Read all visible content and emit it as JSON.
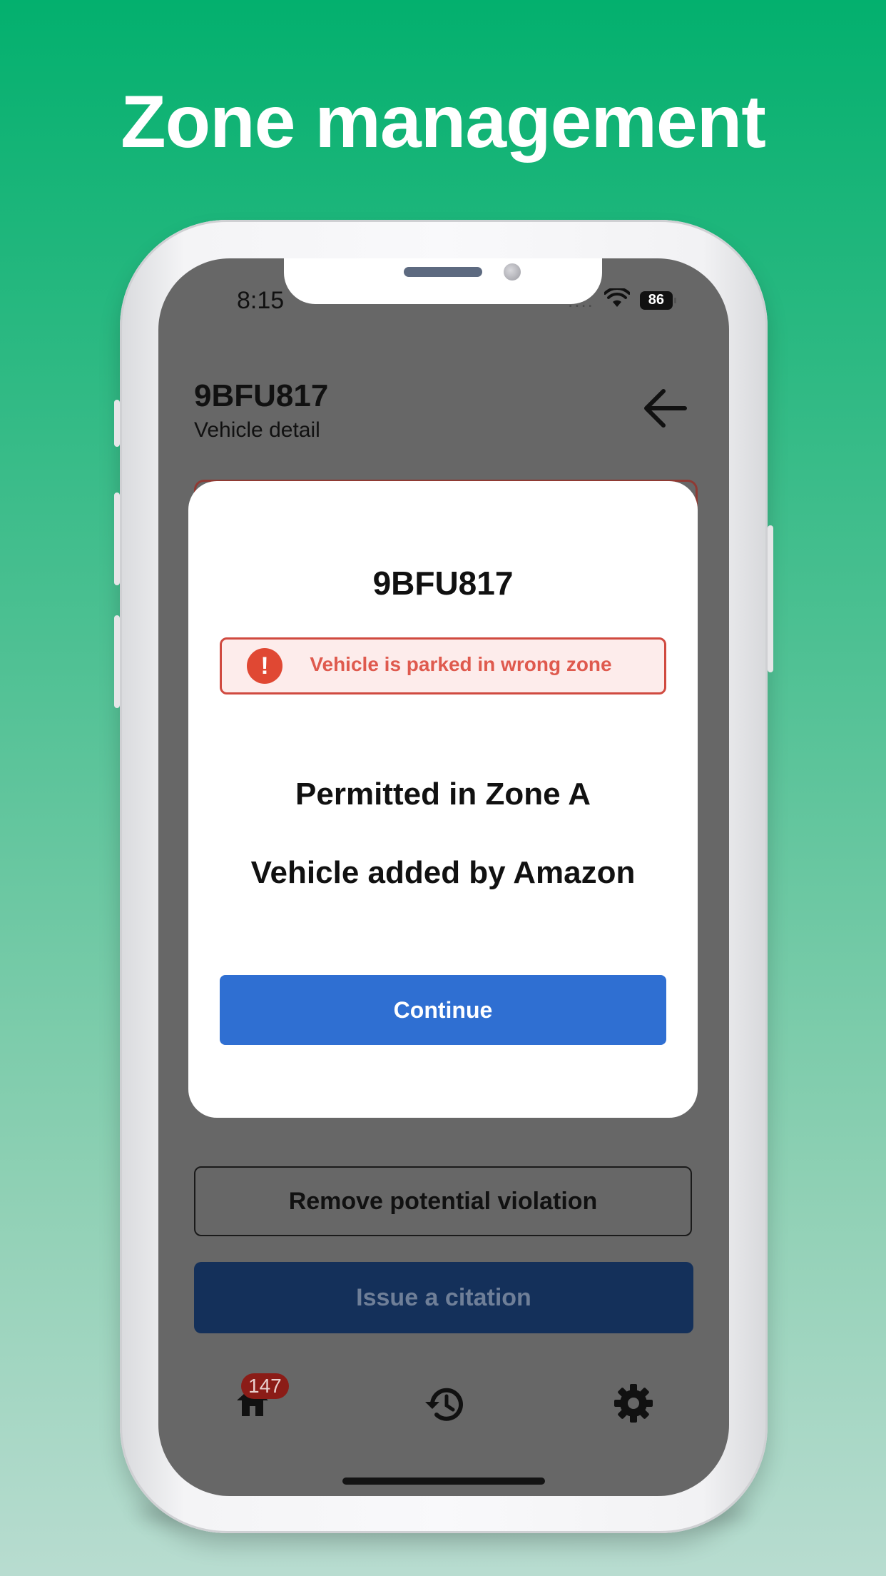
{
  "headline": "Zone management",
  "status_bar": {
    "time": "8:15",
    "signal": "....",
    "battery": "86"
  },
  "header": {
    "plate": "9BFU817",
    "subtitle": "Vehicle detail"
  },
  "modal": {
    "plate": "9BFU817",
    "alert": {
      "icon": "!",
      "text": "Vehicle is parked in wrong zone"
    },
    "zone_line": "Permitted in Zone A",
    "added_by_line": "Vehicle added by Amazon",
    "continue_label": "Continue"
  },
  "actions": {
    "remove_label": "Remove potential violation",
    "citation_label": "Issue a citation"
  },
  "tabbar": {
    "home_badge": "147"
  },
  "colors": {
    "accent": "#2f6fd2",
    "alert": "#df5a4e",
    "citation": "#14305a",
    "overlay": "#676767"
  }
}
